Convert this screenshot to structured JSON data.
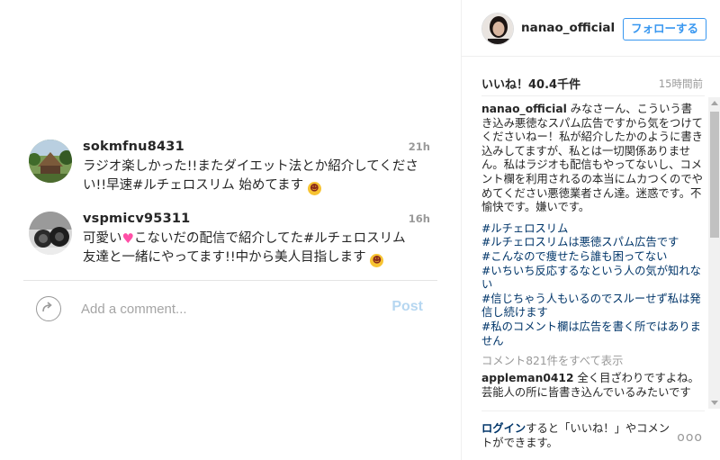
{
  "comments": [
    {
      "username": "sokmfnu8431",
      "time": "21h",
      "text_part1": "ラジオ楽しかった!!またダイエット法とか紹介してください!!早速",
      "hashtag": "#ルチェロスリム",
      "text_part2": " 始めてます",
      "emoji": "laughing-emoji"
    },
    {
      "username": "vspmicv95311",
      "time": "16h",
      "text_part1": "可愛い",
      "text_part2": "こないだの配信で紹介してた",
      "hashtag": "#ルチェロスリム",
      "text_part3": "友達と一緒にやってます!!中から美人目指します",
      "emoji1": "heart-emoji",
      "emoji2": "laughing-emoji"
    }
  ],
  "add_comment": {
    "placeholder": "Add a comment...",
    "post_label": "Post"
  },
  "owner": {
    "username": "nanao_official",
    "follow_label": "フォローする"
  },
  "post": {
    "likes": "いいね！40.4千件",
    "ago": "15時間前"
  },
  "caption": {
    "username": "nanao_official",
    "text": " みなさーん、こういう書き込み悪徳なスパム広告ですから気をつけてくださいねー！私が紹介したかのように書き込みしてますが、私とは一切関係ありません。私はラジオも配信もやってないし、コメント欄を利用されるの本当にムカつくのでやめてください悪徳業者さん達。迷惑です。不愉快です。嫌いです。",
    "hashtags": [
      "#ルチェロスリム",
      "#ルチェロスリムは悪徳スパム広告です",
      "#こんなので痩せたら誰も困ってない",
      "#いちいち反応するなという人の気が知れない",
      "#信じちゃう人もいるのでスルーせず私は発信し続けます",
      "#私のコメント欄は広告を書く所ではありません"
    ]
  },
  "view_all_comments": "コメント821件をすべて表示",
  "sub_comment": {
    "username": "appleman0412",
    "text": " 全く目ざわりですよね。芸能人の所に皆書き込んでいるみたいです"
  },
  "footer": {
    "login_link": "ログイン",
    "login_rest": "すると「いいね！」やコメントができます。",
    "more": "ooo"
  },
  "colors": {
    "link_blue": "#003569",
    "follow_blue": "#3897f0",
    "post_disabled": "#b6d7f1",
    "muted": "#999999"
  }
}
